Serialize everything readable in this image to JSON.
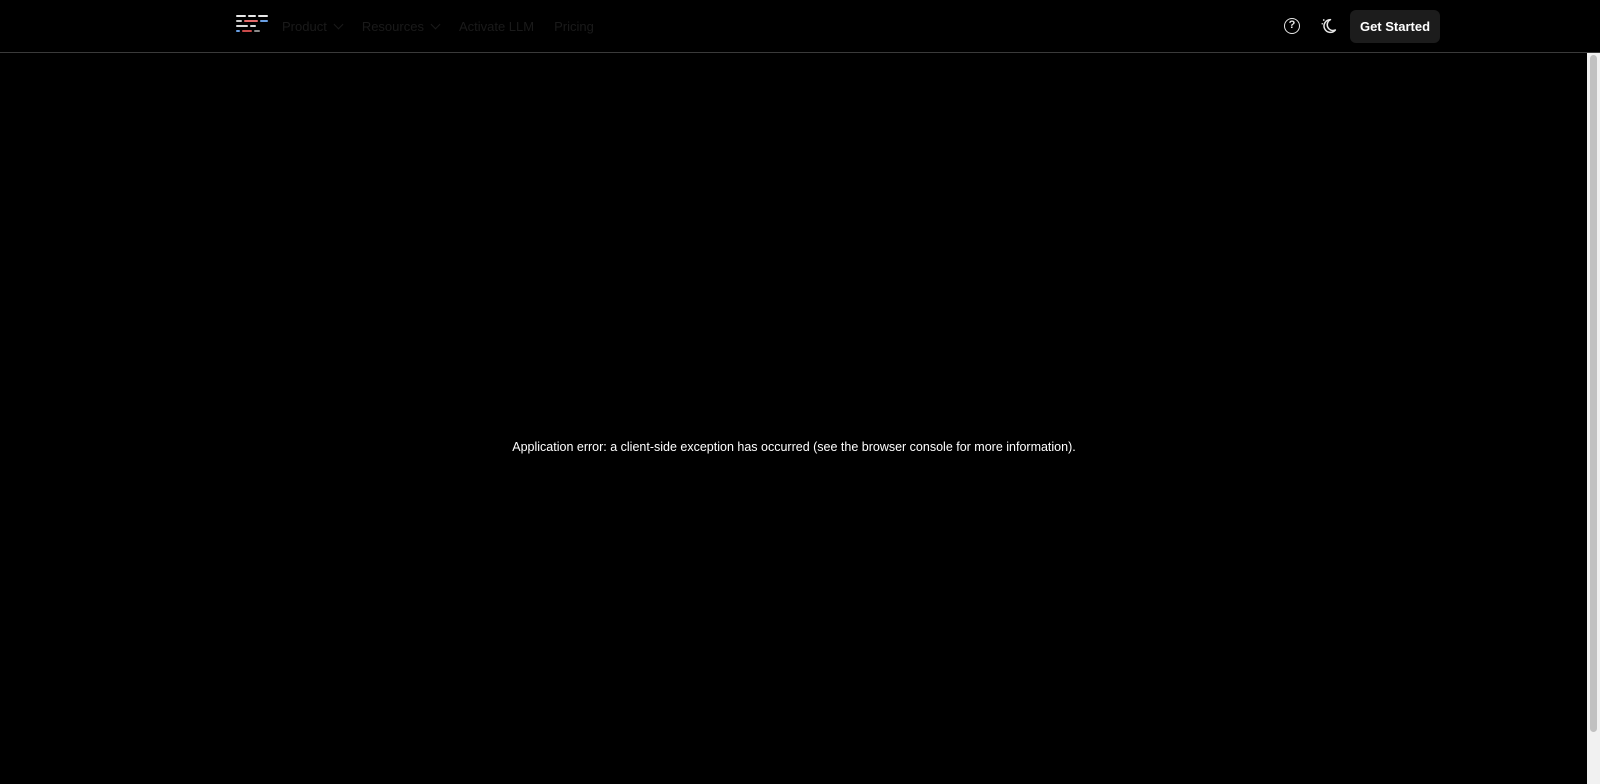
{
  "nav": {
    "product_label": "Product",
    "resources_label": "Resources",
    "activate_llm_label": "Activate LLM",
    "pricing_label": "Pricing",
    "get_started_label": "Get Started",
    "help_glyph": "?"
  },
  "icons": {
    "logo": "logo-icon",
    "help": "help-circle-icon",
    "theme": "moon-icon",
    "chevron": "chevron-down-icon"
  },
  "main": {
    "error_message": "Application error: a client-side exception has occurred (see the browser console for more information)."
  },
  "colors": {
    "background": "#000000",
    "text": "#ffffff",
    "button_bg": "#1c1c1c",
    "border": "#3a3a3a"
  }
}
